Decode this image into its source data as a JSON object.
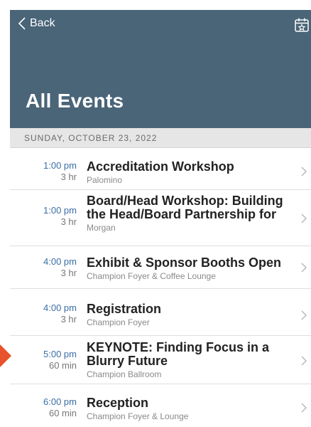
{
  "nav": {
    "back_label": "Back"
  },
  "header": {
    "title": "All Events"
  },
  "date_header": "SUNDAY, OCTOBER 23, 2022",
  "events": [
    {
      "start": "1:00 pm",
      "duration": "3 hr",
      "title": "Accreditation Workshop",
      "location": "Palomino"
    },
    {
      "start": "1:00 pm",
      "duration": "3 hr",
      "title": "Board/Head Workshop: Building the Head/Board Partnership for",
      "location": "Morgan"
    },
    {
      "start": "4:00 pm",
      "duration": "3 hr",
      "title": "Exhibit & Sponsor Booths Open",
      "location": "Champion Foyer & Coffee Lounge"
    },
    {
      "start": "4:00 pm",
      "duration": "3 hr",
      "title": "Registration",
      "location": "Champion Foyer"
    },
    {
      "start": "5:00 pm",
      "duration": "60 min",
      "title": "KEYNOTE: Finding Focus in a Blurry Future",
      "location": "Champion Ballroom"
    },
    {
      "start": "6:00 pm",
      "duration": "60 min",
      "title": "Reception",
      "location": "Champion Foyer & Lounge"
    }
  ],
  "colors": {
    "header_bg": "#4a6478",
    "time_blue": "#3a6ea5",
    "marker": "#e8522c"
  },
  "icons": {
    "back": "chevron-left-icon",
    "calendar": "calendar-star-icon",
    "row": "chevron-right-icon"
  }
}
